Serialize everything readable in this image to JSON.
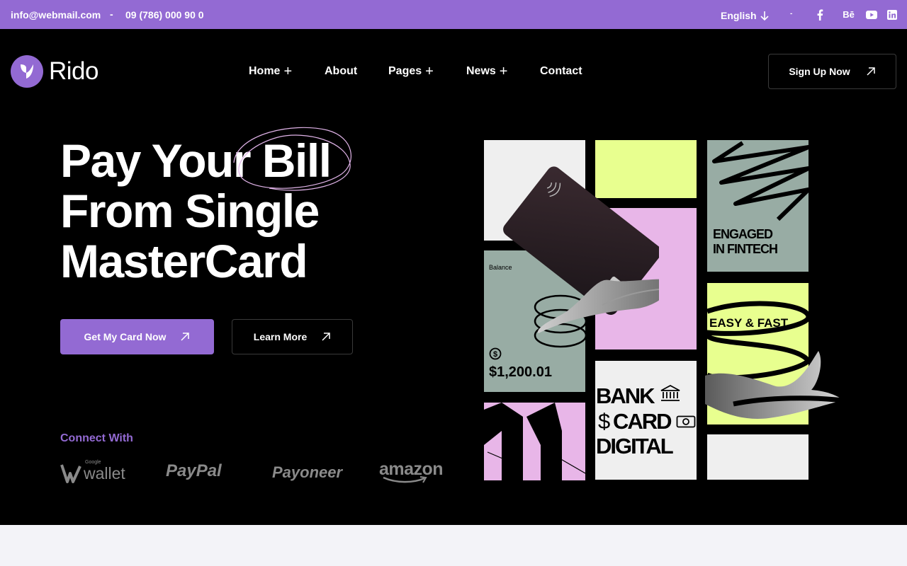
{
  "topbar": {
    "email": "info@webmail.com",
    "separator": "-",
    "phone": "09 (786) 000 90 0",
    "language": "English",
    "social_separator": "-",
    "social_icons": [
      "facebook-icon",
      "behance-icon",
      "youtube-icon",
      "linkedin-icon"
    ],
    "behance_label": "Bē"
  },
  "brand": {
    "name": "Rido",
    "accent": "#936ad3"
  },
  "nav": {
    "items": [
      {
        "label": "Home",
        "has_submenu": true
      },
      {
        "label": "About",
        "has_submenu": false
      },
      {
        "label": "Pages",
        "has_submenu": true
      },
      {
        "label": "News",
        "has_submenu": true
      },
      {
        "label": "Contact",
        "has_submenu": false
      }
    ],
    "submenu_indicator": "+",
    "signup_label": "Sign Up Now"
  },
  "hero": {
    "headline_line1": "Pay Your Bill",
    "headline_line2": "From Single",
    "headline_line3": "MasterCard",
    "primary_button": "Get My Card Now",
    "secondary_button": "Learn More",
    "connect_label": "Connect With",
    "partners": {
      "google_small": "Google",
      "google": "wallet",
      "paypal": "PayPal",
      "payoneer": "Payoneer",
      "amazon": "amazon"
    }
  },
  "collage": {
    "balance_label": "Balance",
    "balance_amount": "$1,200.01",
    "engaged_line1": "ENGAGED",
    "engaged_line2": "IN FINTECH",
    "easy_fast": "EASY & FAST",
    "bank": "BANK",
    "card_symbol": "$",
    "card": "CARD",
    "digital": "DIGITAL",
    "colors": {
      "lime": "#e8ff8f",
      "pink": "#e8b6e8",
      "sage": "#98aca4",
      "light": "#efefef"
    }
  }
}
